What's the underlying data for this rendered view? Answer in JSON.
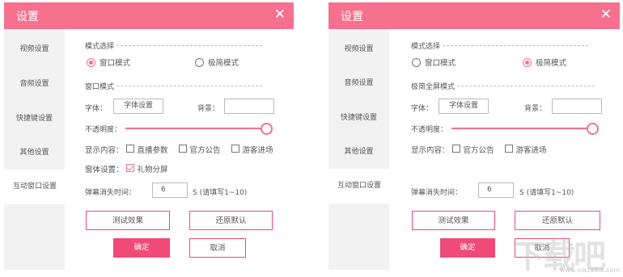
{
  "colors": {
    "accent": "#f7708e",
    "primary_button": "#f04a78",
    "sidebar_bg": "#f2f2f2"
  },
  "dialogs": [
    {
      "title": "设置",
      "close_icon": "close-icon",
      "sidebar": [
        {
          "label": "视频设置"
        },
        {
          "label": "音频设置"
        },
        {
          "label": "快捷键设置"
        },
        {
          "label": "其他设置"
        },
        {
          "label": "互动窗口设置",
          "active": true
        }
      ],
      "mode_section": "模式选择",
      "mode_options": [
        {
          "label": "窗口模式",
          "checked": true
        },
        {
          "label": "极简模式",
          "checked": false
        }
      ],
      "sub_section": "窗口模式",
      "font_label": "字体：",
      "font_button": "字体设置",
      "bg_label": "背景：",
      "opacity_label": "不透明度：",
      "opacity_value": 1.0,
      "display_label": "显示内容：",
      "display_options": [
        {
          "label": "直播参数",
          "checked": false
        },
        {
          "label": "官方公告",
          "checked": false
        },
        {
          "label": "游客进场",
          "checked": false
        }
      ],
      "window_setting_label": "窗体设置：",
      "window_setting_option": {
        "label": "礼物分屏",
        "checked": true
      },
      "timeout_label": "弹幕消失时间：",
      "timeout_value": "6",
      "timeout_hint": "S (请填写1~10)",
      "test_button": "测试效果",
      "restore_button": "还原默认",
      "ok_button": "确定",
      "cancel_button": "取消"
    },
    {
      "title": "设置",
      "close_icon": "close-icon",
      "sidebar": [
        {
          "label": "视频设置"
        },
        {
          "label": "音频设置"
        },
        {
          "label": "快捷键设置"
        },
        {
          "label": "其他设置"
        },
        {
          "label": "互动窗口设置",
          "active": true
        }
      ],
      "mode_section": "模式选择",
      "mode_options": [
        {
          "label": "窗口模式",
          "checked": false
        },
        {
          "label": "极简模式",
          "checked": true
        }
      ],
      "sub_section": "极简全屏模式",
      "font_label": "字体：",
      "font_button": "字体设置",
      "bg_label": "背景：",
      "opacity_label": "不透明度：",
      "opacity_value": 1.0,
      "display_label": "显示内容：",
      "display_options": [
        {
          "label": "官方公告",
          "checked": false
        },
        {
          "label": "游客进场",
          "checked": false
        }
      ],
      "timeout_label": "弹幕消失时间：",
      "timeout_value": "6",
      "timeout_hint": "S (请填写1~10)",
      "test_button": "测试效果",
      "restore_button": "还原默认",
      "ok_button": "确定",
      "cancel_button": "取消"
    }
  ],
  "watermark": {
    "text": "下载吧",
    "url": "www.xiazaiba.com"
  }
}
